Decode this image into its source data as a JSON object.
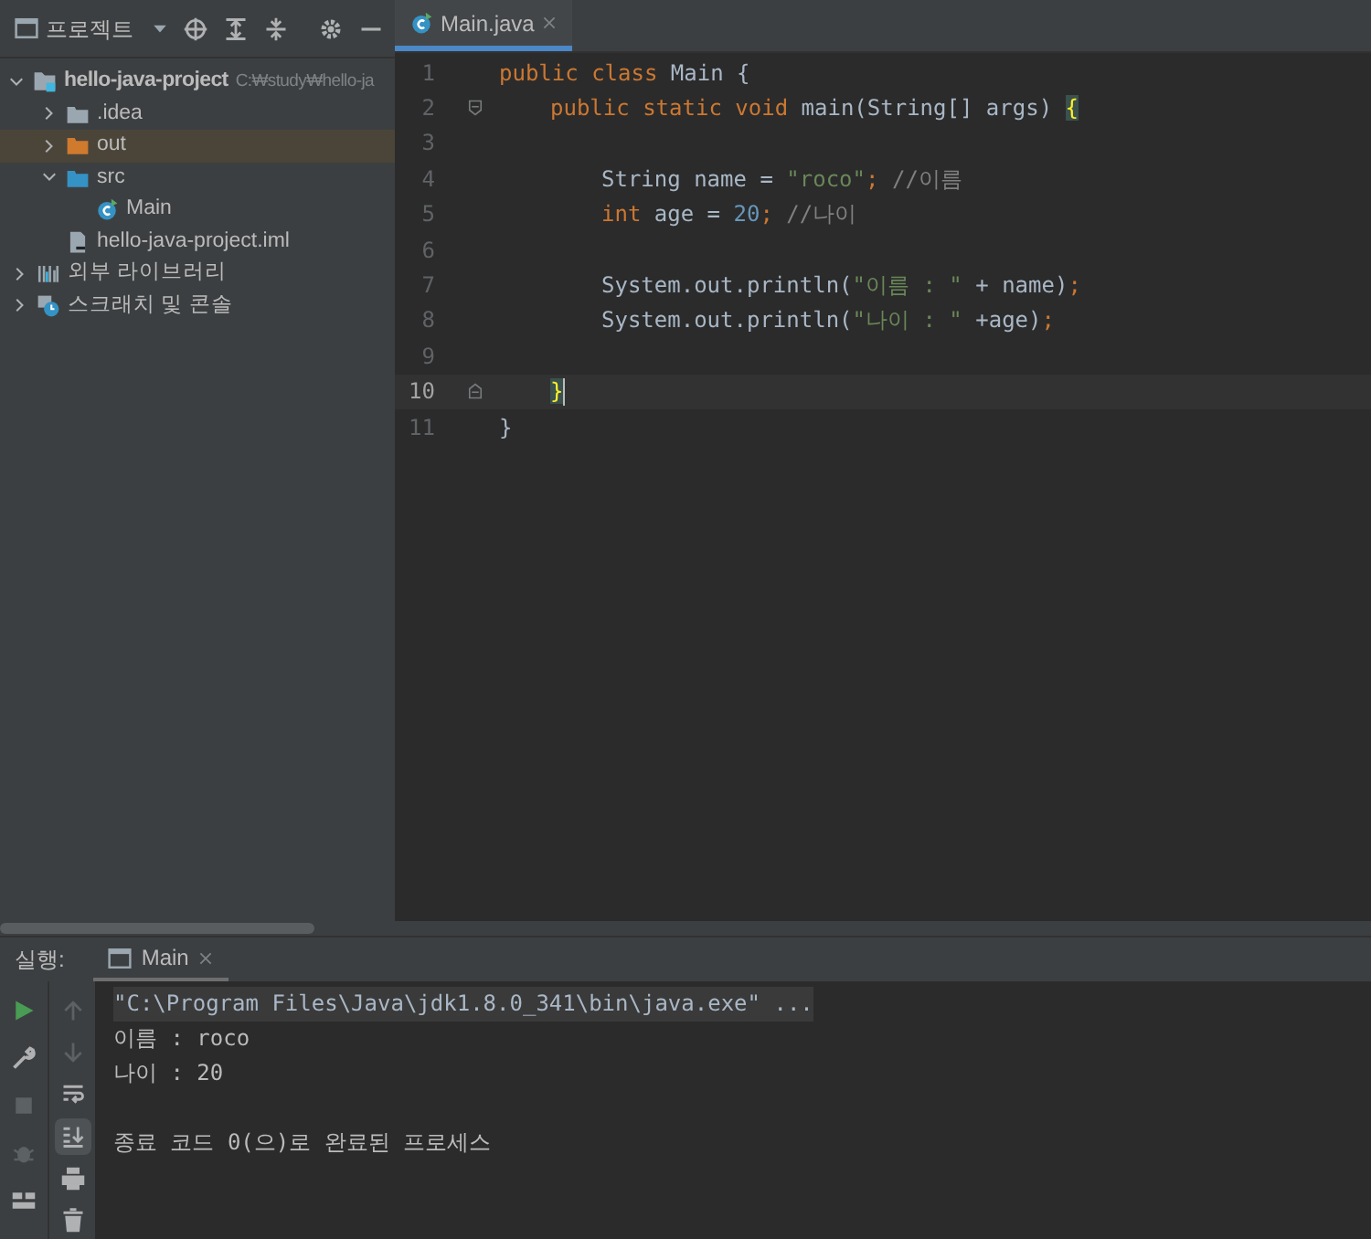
{
  "project_panel": {
    "title": "프로젝트",
    "tree": [
      {
        "label": "hello-java-project",
        "path": "C:₩study₩hello-ja",
        "kind": "project",
        "expanded": true,
        "selected": false,
        "children": [
          {
            "label": ".idea",
            "kind": "folder",
            "expanded": false,
            "selected": false
          },
          {
            "label": "out",
            "kind": "excluded-folder",
            "expanded": false,
            "selected": true
          },
          {
            "label": "src",
            "kind": "source-folder",
            "expanded": true,
            "selected": false,
            "children": [
              {
                "label": "Main",
                "kind": "class",
                "selected": false
              }
            ]
          },
          {
            "label": "hello-java-project.iml",
            "kind": "module-file",
            "selected": false
          }
        ]
      },
      {
        "label": "외부 라이브러리",
        "kind": "library",
        "expanded": false,
        "selected": false
      },
      {
        "label": "스크래치 및 콘솔",
        "kind": "scratch",
        "expanded": false,
        "selected": false
      }
    ]
  },
  "editor": {
    "tabs": [
      {
        "label": "Main.java",
        "selected": true
      }
    ],
    "lines": [
      {
        "number": "1",
        "tokens": [
          {
            "kind": "kw",
            "text": "public class "
          },
          {
            "kind": "plain",
            "text": "Main {"
          }
        ],
        "children": [
          {
            "number": "2",
            "fold_start": true,
            "tokens": [
              {
                "kind": "kw",
                "text": "public static void "
              },
              {
                "kind": "plain",
                "text": "main(String[] args) "
              },
              {
                "kind": "brace",
                "text": "{"
              }
            ],
            "children": [
              {
                "number": "3"
              },
              {
                "number": "4",
                "tokens": [
                  {
                    "kind": "plain",
                    "text": "String name = "
                  },
                  {
                    "kind": "str",
                    "text": "\"roco\""
                  },
                  {
                    "kind": "kw",
                    "text": "; "
                  },
                  {
                    "kind": "cmt",
                    "text": "//이름"
                  }
                ]
              },
              {
                "number": "5",
                "tokens": [
                  {
                    "kind": "kw",
                    "text": "int "
                  },
                  {
                    "kind": "plain",
                    "text": "age = "
                  },
                  {
                    "kind": "num",
                    "text": "20"
                  },
                  {
                    "kind": "kw",
                    "text": "; "
                  },
                  {
                    "kind": "cmt",
                    "text": "//나이"
                  }
                ]
              },
              {
                "number": "6"
              },
              {
                "number": "7",
                "tokens": [
                  {
                    "kind": "plain",
                    "text": "System.out.println("
                  },
                  {
                    "kind": "str",
                    "text": "\"이름 : \""
                  },
                  {
                    "kind": "plain",
                    "text": " + name)"
                  },
                  {
                    "kind": "kw",
                    "text": ";"
                  }
                ]
              },
              {
                "number": "8",
                "tokens": [
                  {
                    "kind": "plain",
                    "text": "System.out.println("
                  },
                  {
                    "kind": "str",
                    "text": "\"나이 : \""
                  },
                  {
                    "kind": "plain",
                    "text": " +age)"
                  },
                  {
                    "kind": "kw",
                    "text": ";"
                  }
                ]
              },
              {
                "number": "9"
              }
            ]
          },
          {
            "number": "10",
            "fold_end": true,
            "current": true,
            "tokens": [
              {
                "kind": "brace",
                "text": "}"
              }
            ]
          }
        ]
      },
      {
        "number": "11",
        "tokens": [
          {
            "kind": "plain",
            "text": "}"
          }
        ]
      }
    ]
  },
  "run_panel": {
    "label": "실행:",
    "tabs": [
      {
        "label": "Main",
        "selected": true
      }
    ],
    "left_tools": [
      {
        "kind": "run",
        "disabled": false
      },
      {
        "kind": "wrench",
        "disabled": false
      },
      {
        "kind": "stop",
        "disabled": true
      },
      {
        "kind": "debug",
        "disabled": true
      },
      {
        "kind": "layout",
        "disabled": false
      }
    ],
    "right_tools": [
      {
        "kind": "up",
        "disabled": true,
        "selected": false
      },
      {
        "kind": "down",
        "disabled": true,
        "selected": false
      },
      {
        "kind": "wrap",
        "disabled": false,
        "selected": false
      },
      {
        "kind": "scroll-end",
        "disabled": false,
        "selected": true
      },
      {
        "kind": "print",
        "disabled": false,
        "selected": false
      },
      {
        "kind": "trash",
        "disabled": false,
        "selected": false
      }
    ],
    "console": [
      {
        "kind": "command",
        "text": "\"C:\\Program Files\\Java\\jdk1.8.0_341\\bin\\java.exe\" ..."
      },
      {
        "kind": "output",
        "text": "이름 : roco"
      },
      {
        "kind": "output",
        "text": "나이 : 20"
      },
      {
        "kind": "exit",
        "text": "종료 코드 0(으)로 완료된 프로세스"
      }
    ]
  }
}
